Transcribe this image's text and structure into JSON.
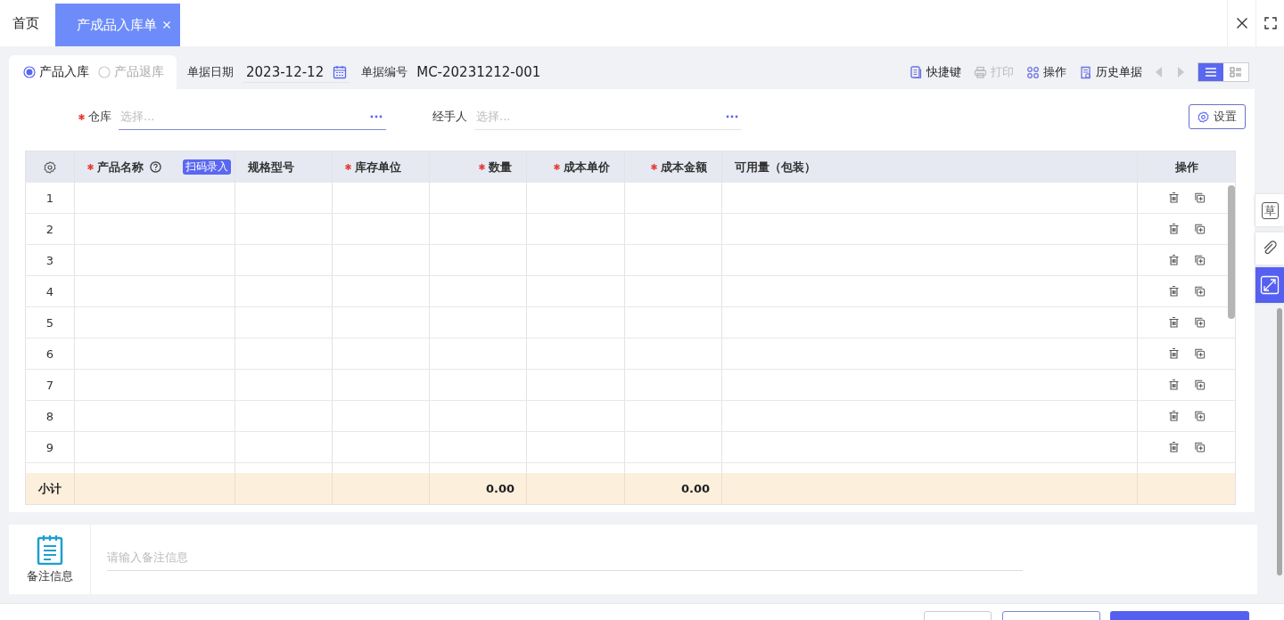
{
  "tabs": [
    {
      "label": "首页",
      "selected": false,
      "closable": false
    },
    {
      "label": "产成品入库单",
      "selected": true,
      "closable": true
    }
  ],
  "mode_options": [
    {
      "label": "产品入库",
      "selected": true
    },
    {
      "label": "产品退库",
      "selected": false
    }
  ],
  "doc_date": {
    "label": "单据日期",
    "value": "2023-12-12"
  },
  "doc_number": {
    "label": "单据编号",
    "value": "MC-20231212-001"
  },
  "toolbar": [
    {
      "label": "快捷键",
      "kind": "doc",
      "disabled": false
    },
    {
      "label": "打印",
      "kind": "printer",
      "disabled": true
    },
    {
      "label": "操作",
      "kind": "grid",
      "disabled": false
    },
    {
      "label": "历史单据",
      "kind": "history",
      "disabled": false
    }
  ],
  "views": [
    {
      "kind": "list",
      "selected": true
    },
    {
      "kind": "detail",
      "selected": false
    }
  ],
  "fields": [
    {
      "label": "仓库",
      "required": true,
      "placeholder": "选择...",
      "focused": true
    },
    {
      "label": "经手人",
      "required": false,
      "placeholder": "选择...",
      "focused": false
    }
  ],
  "settings_button": "设置",
  "table": {
    "columns": [
      {
        "kind": "settings"
      },
      {
        "kind": "text",
        "label": "产品名称",
        "required": true,
        "help": true,
        "badge": "扫码录入"
      },
      {
        "kind": "text",
        "label": "规格型号",
        "required": false
      },
      {
        "kind": "text",
        "label": "库存单位",
        "required": true
      },
      {
        "kind": "number",
        "label": "数量",
        "required": true,
        "total": "0.00"
      },
      {
        "kind": "number",
        "label": "成本单价",
        "required": true
      },
      {
        "kind": "number",
        "label": "成本金额",
        "required": true,
        "total": "0.00"
      },
      {
        "kind": "text",
        "label": "可用量（包装）",
        "required": false
      },
      {
        "kind": "actions",
        "label": "操作"
      }
    ],
    "rows": [
      {
        "number": "1"
      },
      {
        "number": "2"
      },
      {
        "number": "3"
      },
      {
        "number": "4"
      },
      {
        "number": "5"
      },
      {
        "number": "6"
      },
      {
        "number": "7"
      },
      {
        "number": "8"
      },
      {
        "number": "9"
      }
    ],
    "subtotal_label": "小计"
  },
  "remarks": {
    "label": "备注信息",
    "placeholder": "请输入备注信息"
  },
  "side_tools": [
    {
      "kind": "draft",
      "label": "草",
      "selected": false
    },
    {
      "kind": "attachment",
      "selected": false
    },
    {
      "kind": "expand",
      "selected": true
    }
  ],
  "footer_buttons": [
    {
      "kind": "default"
    },
    {
      "kind": "outline"
    },
    {
      "kind": "primary"
    }
  ]
}
